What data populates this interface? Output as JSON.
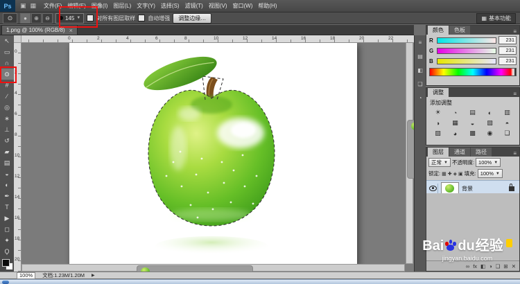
{
  "menubar": {
    "logo": "Ps",
    "app_icons": [
      {
        "name": "launch-bridge-icon",
        "glyph": "▣"
      },
      {
        "name": "view-extras-icon",
        "glyph": "▦"
      }
    ],
    "items": [
      "文件(F)",
      "编辑(E)",
      "图像(I)",
      "图层(L)",
      "文字(Y)",
      "选择(S)",
      "滤镜(T)",
      "视图(V)",
      "窗口(W)",
      "帮助(H)"
    ]
  },
  "optionsbar": {
    "tool_icon_glyph": "⊙",
    "mode_buttons": [
      {
        "name": "new-selection-mode-button",
        "glyph": "●"
      },
      {
        "name": "add-to-selection-mode-button",
        "glyph": "⊕"
      },
      {
        "name": "subtract-from-selection-mode-button",
        "glyph": "⊖"
      }
    ],
    "brush_size": "145",
    "sample_all_layers_label": "对所有图层取样",
    "auto_enhance_label": "自动增强",
    "refine_edge_label": "调整边缘…",
    "workspace_label": "基本功能"
  },
  "tabbar": {
    "title": "1.png @ 100% (RGB/8)",
    "close": "×"
  },
  "rulers": {
    "horizontal": [
      "0",
      "2",
      "4",
      "6",
      "8",
      "10",
      "12",
      "14",
      "16",
      "18",
      "20",
      "22"
    ],
    "vertical": [
      "0",
      "2",
      "4",
      "6",
      "8",
      "10",
      "12",
      "14",
      "16",
      "18",
      "20"
    ]
  },
  "toolbar": {
    "tools": [
      {
        "name": "move-tool",
        "glyph": "↖"
      },
      {
        "name": "rectangular-marquee-tool",
        "glyph": "▭"
      },
      {
        "name": "lasso-tool",
        "glyph": "∩"
      },
      {
        "name": "quick-selection-tool",
        "glyph": "⊙"
      },
      {
        "name": "crop-tool",
        "glyph": "#"
      },
      {
        "name": "eyedropper-tool",
        "glyph": "∕"
      },
      {
        "name": "spot-healing-brush-tool",
        "glyph": "◎"
      },
      {
        "name": "brush-tool",
        "glyph": "∗"
      },
      {
        "name": "clone-stamp-tool",
        "glyph": "⊥"
      },
      {
        "name": "history-brush-tool",
        "glyph": "↺"
      },
      {
        "name": "eraser-tool",
        "glyph": "▰"
      },
      {
        "name": "gradient-tool",
        "glyph": "▤"
      },
      {
        "name": "blur-tool",
        "glyph": "◒"
      },
      {
        "name": "dodge-tool",
        "glyph": "◐"
      },
      {
        "name": "pen-tool",
        "glyph": "✒"
      },
      {
        "name": "type-tool",
        "glyph": "T"
      },
      {
        "name": "path-selection-tool",
        "glyph": "▶"
      },
      {
        "name": "shape-tool",
        "glyph": "◻"
      },
      {
        "name": "hand-tool",
        "glyph": "✦"
      },
      {
        "name": "zoom-tool",
        "glyph": "Ϙ"
      }
    ]
  },
  "panels": {
    "dock_icons": [
      "≡",
      "▤",
      "◧",
      "❏",
      "◔"
    ],
    "color": {
      "tabs": [
        "颜色",
        "色板"
      ],
      "channels": [
        {
          "label": "R",
          "value": "231"
        },
        {
          "label": "G",
          "value": "231"
        },
        {
          "label": "B",
          "value": "231"
        }
      ]
    },
    "adjustments": {
      "tab": "调整",
      "add_label": "添加调整",
      "icons": [
        "☀",
        "◔",
        "▤",
        "◐",
        "▥",
        "◑",
        "▦",
        "◒",
        "▧",
        "◓",
        "▨",
        "◕",
        "▩",
        "◉",
        "❏"
      ]
    },
    "layers": {
      "tabs": [
        "图层",
        "通道",
        "路径"
      ],
      "blend_mode": "正常",
      "opacity_label": "不透明度:",
      "opacity_value": "100%",
      "lock_label": "锁定:",
      "lock_icons": [
        "▦",
        "✚",
        "◈",
        "▣"
      ],
      "fill_label": "填充:",
      "fill_value": "100%",
      "layer_name": "背景",
      "bottom_icons": [
        {
          "name": "link-layers-icon",
          "glyph": "∞"
        },
        {
          "name": "layer-style-icon",
          "glyph": "fx"
        },
        {
          "name": "add-layer-mask-icon",
          "glyph": "◧"
        },
        {
          "name": "new-adjustment-layer-icon",
          "glyph": "◑"
        },
        {
          "name": "new-group-icon",
          "glyph": "❏"
        },
        {
          "name": "new-layer-icon",
          "glyph": "⊞"
        },
        {
          "name": "delete-layer-icon",
          "glyph": "✕"
        }
      ]
    }
  },
  "statusbar": {
    "zoom": "100%",
    "doc_info": "文档:1.23M/1.20M",
    "expand_glyph": "▶"
  },
  "watermark": {
    "text_bai": "Bai",
    "text_du": "du",
    "text_cn": "经验",
    "url": "jingyan.baidu.com"
  },
  "colors": {
    "annotation_red": "#ee1111",
    "baidu_blue": "#2932e1",
    "baidu_red": "#e10601",
    "badge_yellow": "#ffce00"
  }
}
